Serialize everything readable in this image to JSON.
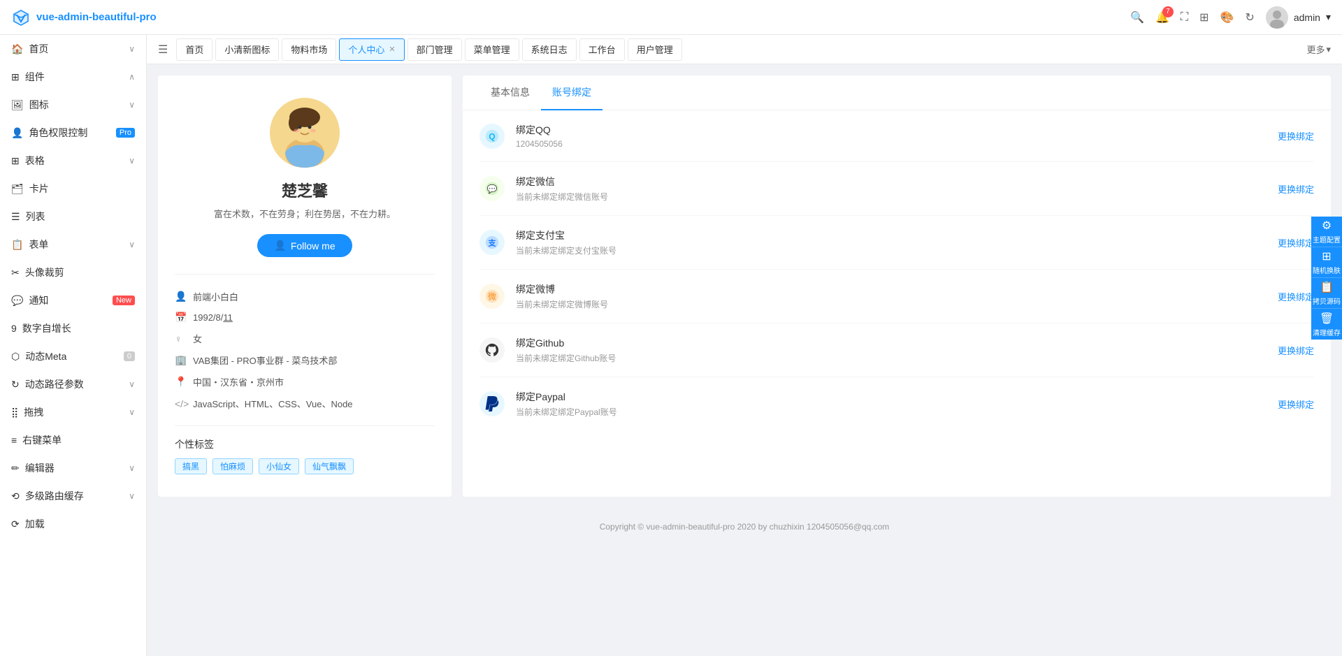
{
  "app": {
    "title": "vue-admin-beautiful-pro",
    "logo_text": "vue-admin-beautiful-pro"
  },
  "navbar": {
    "search_title": "搜索",
    "bell_count": "7",
    "fullscreen_title": "全屏",
    "layout_title": "布局",
    "theme_title": "主题",
    "refresh_title": "刷新",
    "user_name": "admin",
    "user_dropdown": "▾"
  },
  "tabs": {
    "toggle_icon": "☰",
    "items": [
      {
        "label": "首页",
        "active": false,
        "closable": false
      },
      {
        "label": "小清新图标",
        "active": false,
        "closable": false
      },
      {
        "label": "物料市场",
        "active": false,
        "closable": false
      },
      {
        "label": "个人中心",
        "active": true,
        "closable": true
      },
      {
        "label": "部门管理",
        "active": false,
        "closable": false
      },
      {
        "label": "菜单管理",
        "active": false,
        "closable": false
      },
      {
        "label": "系统日志",
        "active": false,
        "closable": false
      },
      {
        "label": "工作台",
        "active": false,
        "closable": false
      },
      {
        "label": "用户管理",
        "active": false,
        "closable": false
      }
    ],
    "more_label": "更多"
  },
  "sidebar": {
    "items": [
      {
        "label": "首页",
        "icon": "🏠",
        "has_chevron": true,
        "badge": null
      },
      {
        "label": "组件",
        "icon": "⊞",
        "has_chevron": true,
        "badge": null
      },
      {
        "label": "图标",
        "icon": "🖼",
        "has_chevron": true,
        "badge": null
      },
      {
        "label": "角色权限控制",
        "icon": "👤",
        "has_chevron": false,
        "badge": "Pro",
        "badge_type": "pro"
      },
      {
        "label": "表格",
        "icon": "⊞",
        "has_chevron": true,
        "badge": null
      },
      {
        "label": "卡片",
        "icon": "🗂",
        "has_chevron": false,
        "badge": null
      },
      {
        "label": "列表",
        "icon": "☰",
        "has_chevron": false,
        "badge": null
      },
      {
        "label": "表单",
        "icon": "📋",
        "has_chevron": true,
        "badge": null
      },
      {
        "label": "头像裁剪",
        "icon": "✂",
        "has_chevron": false,
        "badge": null
      },
      {
        "label": "通知",
        "icon": "💬",
        "has_chevron": false,
        "badge": "New",
        "badge_type": "new"
      },
      {
        "label": "数字自增长",
        "icon": "9",
        "has_chevron": false,
        "badge": null
      },
      {
        "label": "动态Meta",
        "icon": "⬡",
        "has_chevron": false,
        "badge": "0",
        "badge_type": "zero"
      },
      {
        "label": "动态路径参数",
        "icon": "↻",
        "has_chevron": true,
        "badge": null
      },
      {
        "label": "拖拽",
        "icon": "⣿",
        "has_chevron": true,
        "badge": null
      },
      {
        "label": "右键菜单",
        "icon": "≡",
        "has_chevron": false,
        "badge": null
      },
      {
        "label": "编辑器",
        "icon": "✏",
        "has_chevron": true,
        "badge": null
      },
      {
        "label": "多级路由缓存",
        "icon": "⟲",
        "has_chevron": true,
        "badge": null
      },
      {
        "label": "加载",
        "icon": "⟳",
        "has_chevron": false,
        "badge": null
      }
    ]
  },
  "profile": {
    "avatar_emoji": "🧑‍🎨",
    "name": "楚芝馨",
    "motto": "富在术数，不在劳身；利在势居，不在力耕。",
    "follow_btn": "Follow me",
    "info": [
      {
        "icon": "👤",
        "text": "前端小白白"
      },
      {
        "icon": "📅",
        "text": "1992/8/11"
      },
      {
        "icon": "♀",
        "text": "女"
      },
      {
        "icon": "🏢",
        "text": "VAB集团 - PRO事业群 - 菜鸟技术部"
      },
      {
        "icon": "📍",
        "text": "中国・汉东省・京州市"
      },
      {
        "icon": "</>",
        "text": "JavaScript、HTML、CSS、Vue、Node"
      }
    ],
    "tags_title": "个性标签",
    "tags": [
      "搞黑",
      "怕麻烦",
      "小仙女",
      "仙气飘飘"
    ]
  },
  "account_binding": {
    "tabs": [
      {
        "label": "基本信息",
        "active": false
      },
      {
        "label": "账号绑定",
        "active": true
      }
    ],
    "bindings": [
      {
        "platform": "qq",
        "title": "绑定QQ",
        "sub": "1204505056",
        "action": "更换绑定",
        "icon_type": "qq"
      },
      {
        "platform": "wechat",
        "title": "绑定微信",
        "sub": "当前未绑定绑定微信账号",
        "action": "更换绑定",
        "icon_type": "wechat"
      },
      {
        "platform": "alipay",
        "title": "绑定支付宝",
        "sub": "当前未绑定绑定支付宝账号",
        "action": "更换绑定",
        "icon_type": "alipay"
      },
      {
        "platform": "weibo",
        "title": "绑定微博",
        "sub": "当前未绑定绑定微博账号",
        "action": "更换绑定",
        "icon_type": "weibo"
      },
      {
        "platform": "github",
        "title": "绑定Github",
        "sub": "当前未绑定绑定Github账号",
        "action": "更换绑定",
        "icon_type": "github"
      },
      {
        "platform": "paypal",
        "title": "绑定Paypal",
        "sub": "当前未绑定绑定Paypal账号",
        "action": "更换绑定",
        "icon_type": "paypal"
      }
    ]
  },
  "float_panel": {
    "buttons": [
      {
        "icon": "⚙",
        "label": "主题配置"
      },
      {
        "icon": "⊞",
        "label": "随机换肤"
      },
      {
        "icon": "📋",
        "label": "拷贝源码"
      },
      {
        "icon": "🗑",
        "label": "清理缓存"
      }
    ]
  },
  "footer": {
    "text": "Copyright © vue-admin-beautiful-pro 2020 by chuzhixin 1204505056@qq.com"
  }
}
